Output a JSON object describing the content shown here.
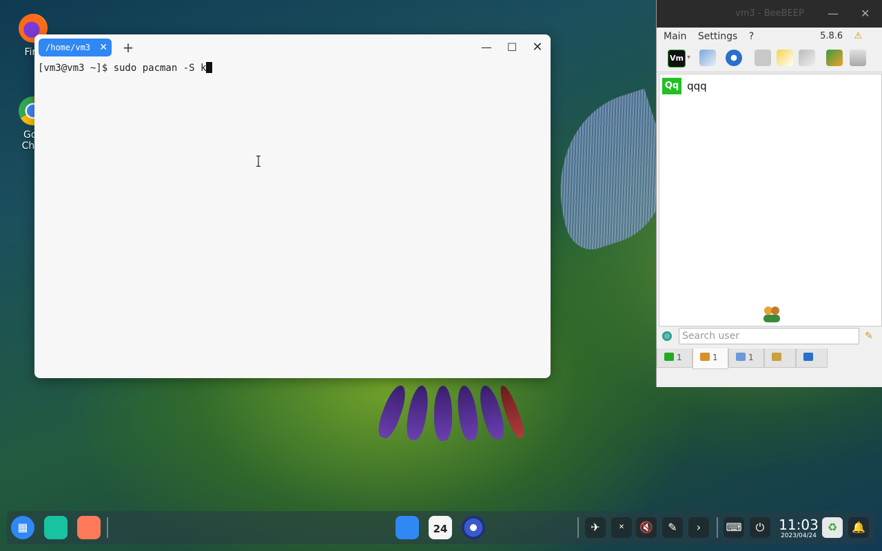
{
  "desktop": {
    "icons": [
      {
        "label_line1": "Fire",
        "label_line2": ""
      },
      {
        "label_line1": "Goo",
        "label_line2": "Chro"
      }
    ]
  },
  "terminal": {
    "tab_label": "/home/vm3",
    "prompt_line": "[vm3@vm3 ~]$ sudo pacman -S k"
  },
  "beebeep": {
    "title": "vm3 - BeeBEEP",
    "menu": [
      "Main",
      "Settings",
      "?"
    ],
    "version": "5.8.6",
    "toolbar_profile": "Vm",
    "users": [
      {
        "badge": "Qq",
        "name": "qqq"
      }
    ],
    "search_placeholder": "Search user",
    "tabs": [
      {
        "count": "1",
        "icon": "users-list-icon"
      },
      {
        "count": "1",
        "icon": "group-icon"
      },
      {
        "count": "1",
        "icon": "chat-icon"
      },
      {
        "count": "",
        "icon": "groups-icon"
      },
      {
        "count": "",
        "icon": "share-icon"
      }
    ]
  },
  "taskbar": {
    "calendar_day": "24",
    "time": "11:03",
    "date": "2023/04/24"
  }
}
